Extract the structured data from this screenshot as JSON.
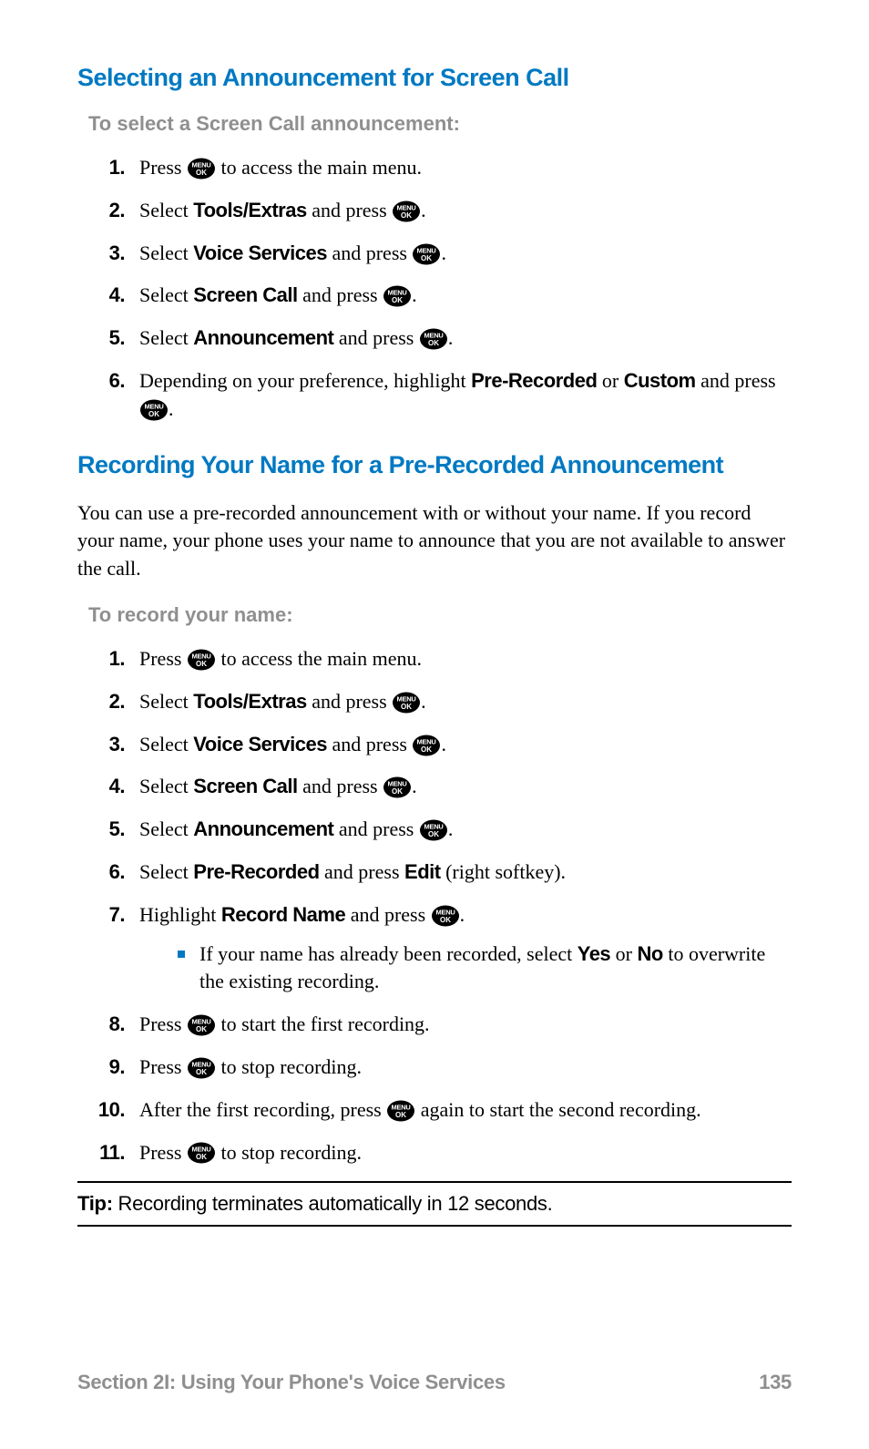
{
  "s1": {
    "heading": "Selecting an Announcement for Screen Call",
    "subheading": "To select a Screen Call announcement:",
    "steps": {
      "1a": "Press ",
      "1b": " to access the main menu.",
      "2a": "Select ",
      "2bold": "Tools/Extras",
      "2b": " and press ",
      "3a": "Select ",
      "3bold": "Voice Services",
      "3b": " and press ",
      "4a": "Select ",
      "4bold": "Screen Call",
      "4b": " and press ",
      "5a": "Select ",
      "5bold": "Announcement",
      "5b": " and press ",
      "6a": "Depending on your preference, highlight ",
      "6bold1": "Pre-Recorded",
      "6mid": " or ",
      "6bold2": "Custom",
      "6b": " and press "
    }
  },
  "s2": {
    "heading": "Recording Your Name for a Pre-Recorded Announcement",
    "intro": "You can use a pre-recorded announcement with or without your name. If you record your name, your phone uses your name to announce that you are not available to answer the call.",
    "subheading": "To record your name:",
    "steps": {
      "1a": "Press ",
      "1b": " to access the main menu.",
      "2a": "Select ",
      "2bold": "Tools/Extras",
      "2b": " and press ",
      "3a": "Select ",
      "3bold": "Voice Services",
      "3b": " and press ",
      "4a": "Select ",
      "4bold": "Screen Call",
      "4b": " and press ",
      "5a": "Select ",
      "5bold": "Announcement",
      "5b": " and press ",
      "6a": "Select ",
      "6bold1": "Pre-Recorded",
      "6mid": " and press ",
      "6bold2": "Edit",
      "6b": " (right softkey).",
      "7a": "Highlight ",
      "7bold": "Record Name",
      "7b": " and press ",
      "7sub_a": "If your name has already been recorded, select ",
      "7sub_yes": "Yes",
      "7sub_or": " or ",
      "7sub_no": "No",
      "7sub_b": " to overwrite the existing recording.",
      "8a": "Press ",
      "8b": " to start the first recording.",
      "9a": "Press ",
      "9b": " to stop recording.",
      "10a": "After the first recording, press ",
      "10b": " again to start the second recording.",
      "11a": "Press ",
      "11b": " to stop recording."
    }
  },
  "tip": {
    "label": "Tip:",
    "text": " Recording terminates automatically in 12 seconds."
  },
  "footer": {
    "section": "Section 2I: Using Your Phone's Voice Services",
    "page": "135"
  },
  "period": "."
}
